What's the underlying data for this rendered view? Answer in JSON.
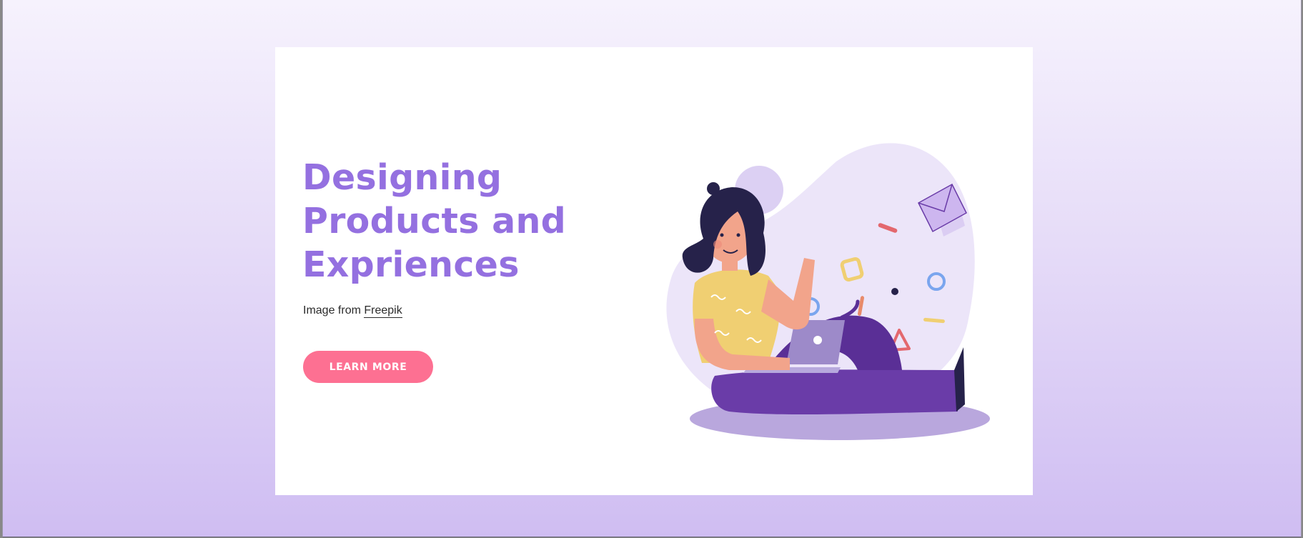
{
  "hero": {
    "title_lines": [
      "Designing",
      "Products and",
      "Expriences"
    ],
    "credit_prefix": "Image from ",
    "credit_link": "Freepik",
    "cta_label": "LEARN MORE"
  },
  "colors": {
    "page_gradient_top": "#f6f2fd",
    "page_gradient_bottom": "#cfbdf2",
    "card_background": "#ffffff",
    "title": "#9470e0",
    "cta_background": "#fd7092",
    "cta_text": "#ffffff",
    "illustration_purple": "#6a3ca8",
    "illustration_yellow": "#f0cf72",
    "illustration_blob": "#ece5f9"
  },
  "illustration": {
    "icon": "woman-with-laptop-illustration"
  }
}
